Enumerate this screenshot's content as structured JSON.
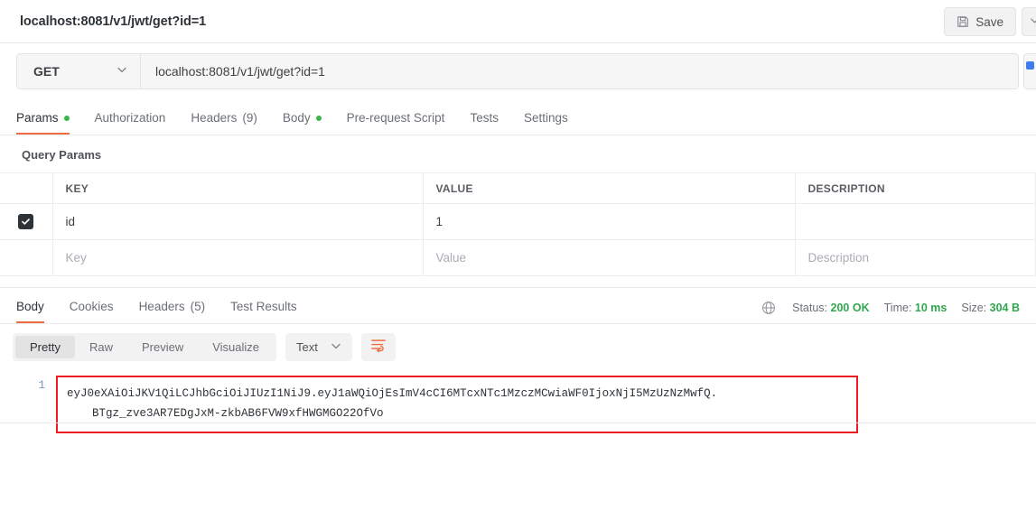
{
  "titlebar": {
    "request_name": "localhost:8081/v1/jwt/get?id=1",
    "save_label": "Save"
  },
  "url_bar": {
    "method": "GET",
    "url": "localhost:8081/v1/jwt/get?id=1"
  },
  "request_tabs": [
    {
      "label": "Params",
      "dot": true,
      "count": "",
      "active": true
    },
    {
      "label": "Authorization",
      "dot": false,
      "count": "",
      "active": false
    },
    {
      "label": "Headers",
      "dot": false,
      "count": "(9)",
      "active": false
    },
    {
      "label": "Body",
      "dot": true,
      "count": "",
      "active": false
    },
    {
      "label": "Pre-request Script",
      "dot": false,
      "count": "",
      "active": false
    },
    {
      "label": "Tests",
      "dot": false,
      "count": "",
      "active": false
    },
    {
      "label": "Settings",
      "dot": false,
      "count": "",
      "active": false
    }
  ],
  "query_params": {
    "section_title": "Query Params",
    "columns": {
      "key": "KEY",
      "value": "VALUE",
      "description": "DESCRIPTION"
    },
    "rows": [
      {
        "checked": true,
        "key": "id",
        "value": "1",
        "description": ""
      }
    ],
    "placeholder_row": {
      "key": "Key",
      "value": "Value",
      "description": "Description"
    }
  },
  "response": {
    "tabs": [
      {
        "label": "Body",
        "count": "",
        "active": true
      },
      {
        "label": "Cookies",
        "count": "",
        "active": false
      },
      {
        "label": "Headers",
        "count": "(5)",
        "active": false
      },
      {
        "label": "Test Results",
        "count": "",
        "active": false
      }
    ],
    "status": {
      "status_label": "Status:",
      "status_value": "200 OK",
      "time_label": "Time:",
      "time_value": "10 ms",
      "size_label": "Size:",
      "size_value": "304 B"
    },
    "viewer": {
      "modes": [
        {
          "label": "Pretty",
          "active": true
        },
        {
          "label": "Raw",
          "active": false
        },
        {
          "label": "Preview",
          "active": false
        },
        {
          "label": "Visualize",
          "active": false
        }
      ],
      "format": "Text"
    },
    "body": {
      "line_number": "1",
      "line_1": "eyJ0eXAiOiJKV1QiLCJhbGciOiJIUzI1NiJ9.eyJ1aWQiOjEsImV4cCI6MTcxNTc1MzczMCwiaWF0IjoxNjI5MzUzNzMwfQ.",
      "line_2": "BTgz_zve3AR7EDgJxM-zkbAB6FVW9xfHWGMGO22OfVo"
    }
  },
  "colors": {
    "accent": "#ef6c42",
    "success": "#2fa84f",
    "dot_green": "#3bb54a",
    "annotation_red": "#ee1c25",
    "send_blue": "#3f7cf0"
  }
}
